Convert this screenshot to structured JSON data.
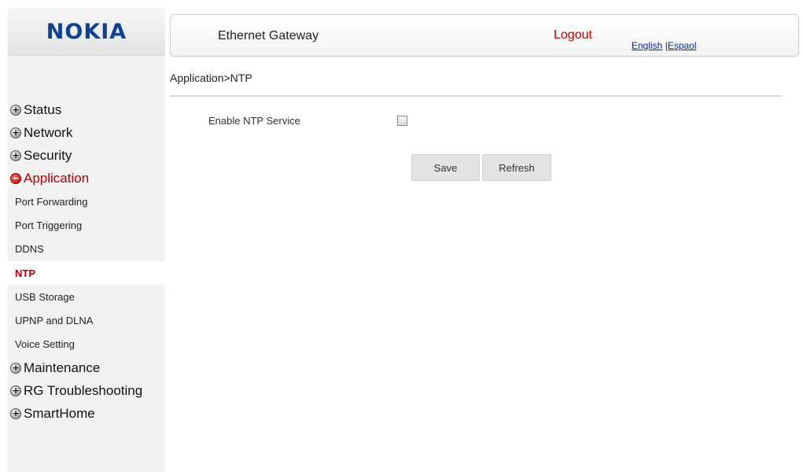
{
  "brand": {
    "logo": "NOKIA"
  },
  "header": {
    "title": "Ethernet Gateway",
    "logout": "Logout",
    "lang_english": "English",
    "lang_separator": " |",
    "lang_espanol": "Espaol"
  },
  "breadcrumb": "Application>NTP",
  "sidebar": {
    "status": {
      "label": "Status",
      "icon": "plus-circle-icon"
    },
    "network": {
      "label": "Network",
      "icon": "plus-circle-icon"
    },
    "security": {
      "label": "Security",
      "icon": "plus-circle-icon"
    },
    "application": {
      "label": "Application",
      "icon": "minus-circle-icon"
    },
    "sub": {
      "port_forwarding": "Port Forwarding",
      "port_triggering": "Port Triggering",
      "ddns": "DDNS",
      "ntp": "NTP",
      "usb_storage": "USB Storage",
      "upnp_dlna": "UPNP and DLNA",
      "voice_setting": "Voice Setting"
    },
    "maintenance": {
      "label": "Maintenance",
      "icon": "plus-circle-icon"
    },
    "rg_troubleshooting": {
      "label": "RG Troubleshooting",
      "icon": "plus-circle-icon"
    },
    "smarthome": {
      "label": "SmartHome",
      "icon": "plus-circle-icon"
    }
  },
  "form": {
    "enable_label": "Enable NTP Service",
    "enable_checked": false
  },
  "buttons": {
    "save": "Save",
    "refresh": "Refresh"
  },
  "colors": {
    "brand_blue": "#124191",
    "accent_red": "#b40000",
    "link_blue": "#0d2a88",
    "sidebar_bg": "#f2f2f2"
  }
}
